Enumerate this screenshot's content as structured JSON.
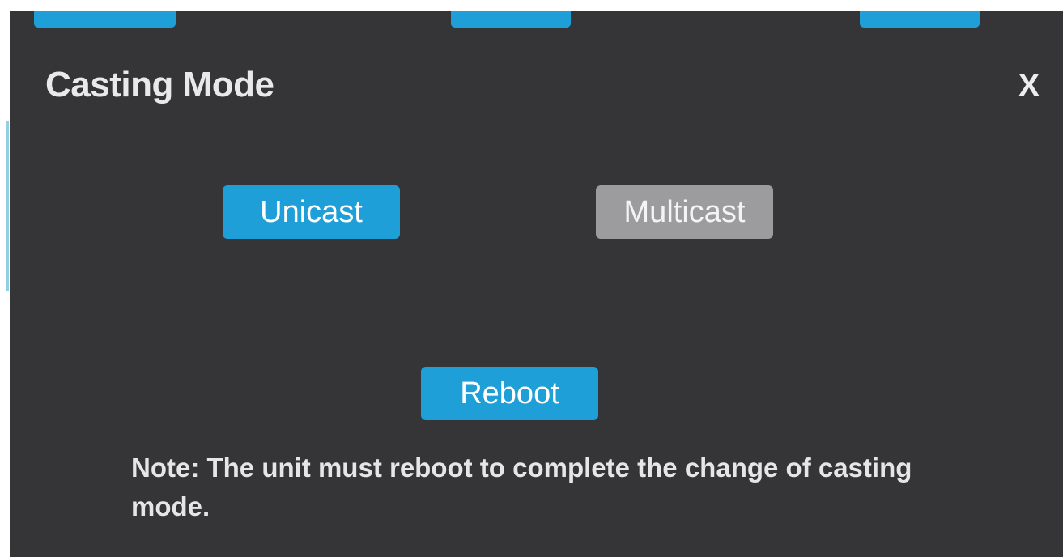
{
  "dialog": {
    "title": "Casting Mode",
    "close_label": "X",
    "unicast_label": "Unicast",
    "multicast_label": "Multicast",
    "reboot_label": "Reboot",
    "note": "Note: The unit must reboot to complete the change of casting mode."
  },
  "colors": {
    "background": "#353538",
    "accent": "#1e9fd8",
    "inactive": "#9c9c9e"
  },
  "icons": {
    "close": "close-icon"
  }
}
